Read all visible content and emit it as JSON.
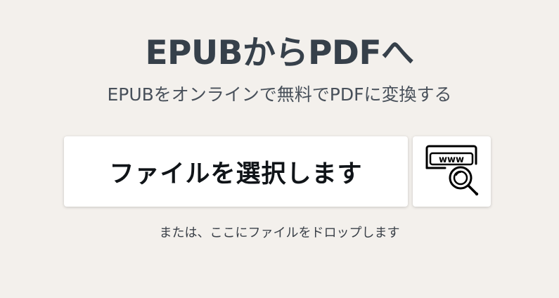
{
  "header": {
    "title": "EPUBからPDFへ",
    "subtitle": "EPUBをオンラインで無料でPDFに変換する"
  },
  "upload": {
    "choose_file_label": "ファイルを選択します",
    "url_icon": "www-magnifier-icon",
    "url_icon_text": "www",
    "drop_hint": "または、ここにファイルをドロップします"
  },
  "colors": {
    "background": "#f3f0ec",
    "title": "#36404a",
    "button_background": "#ffffff",
    "button_text": "#101418"
  }
}
